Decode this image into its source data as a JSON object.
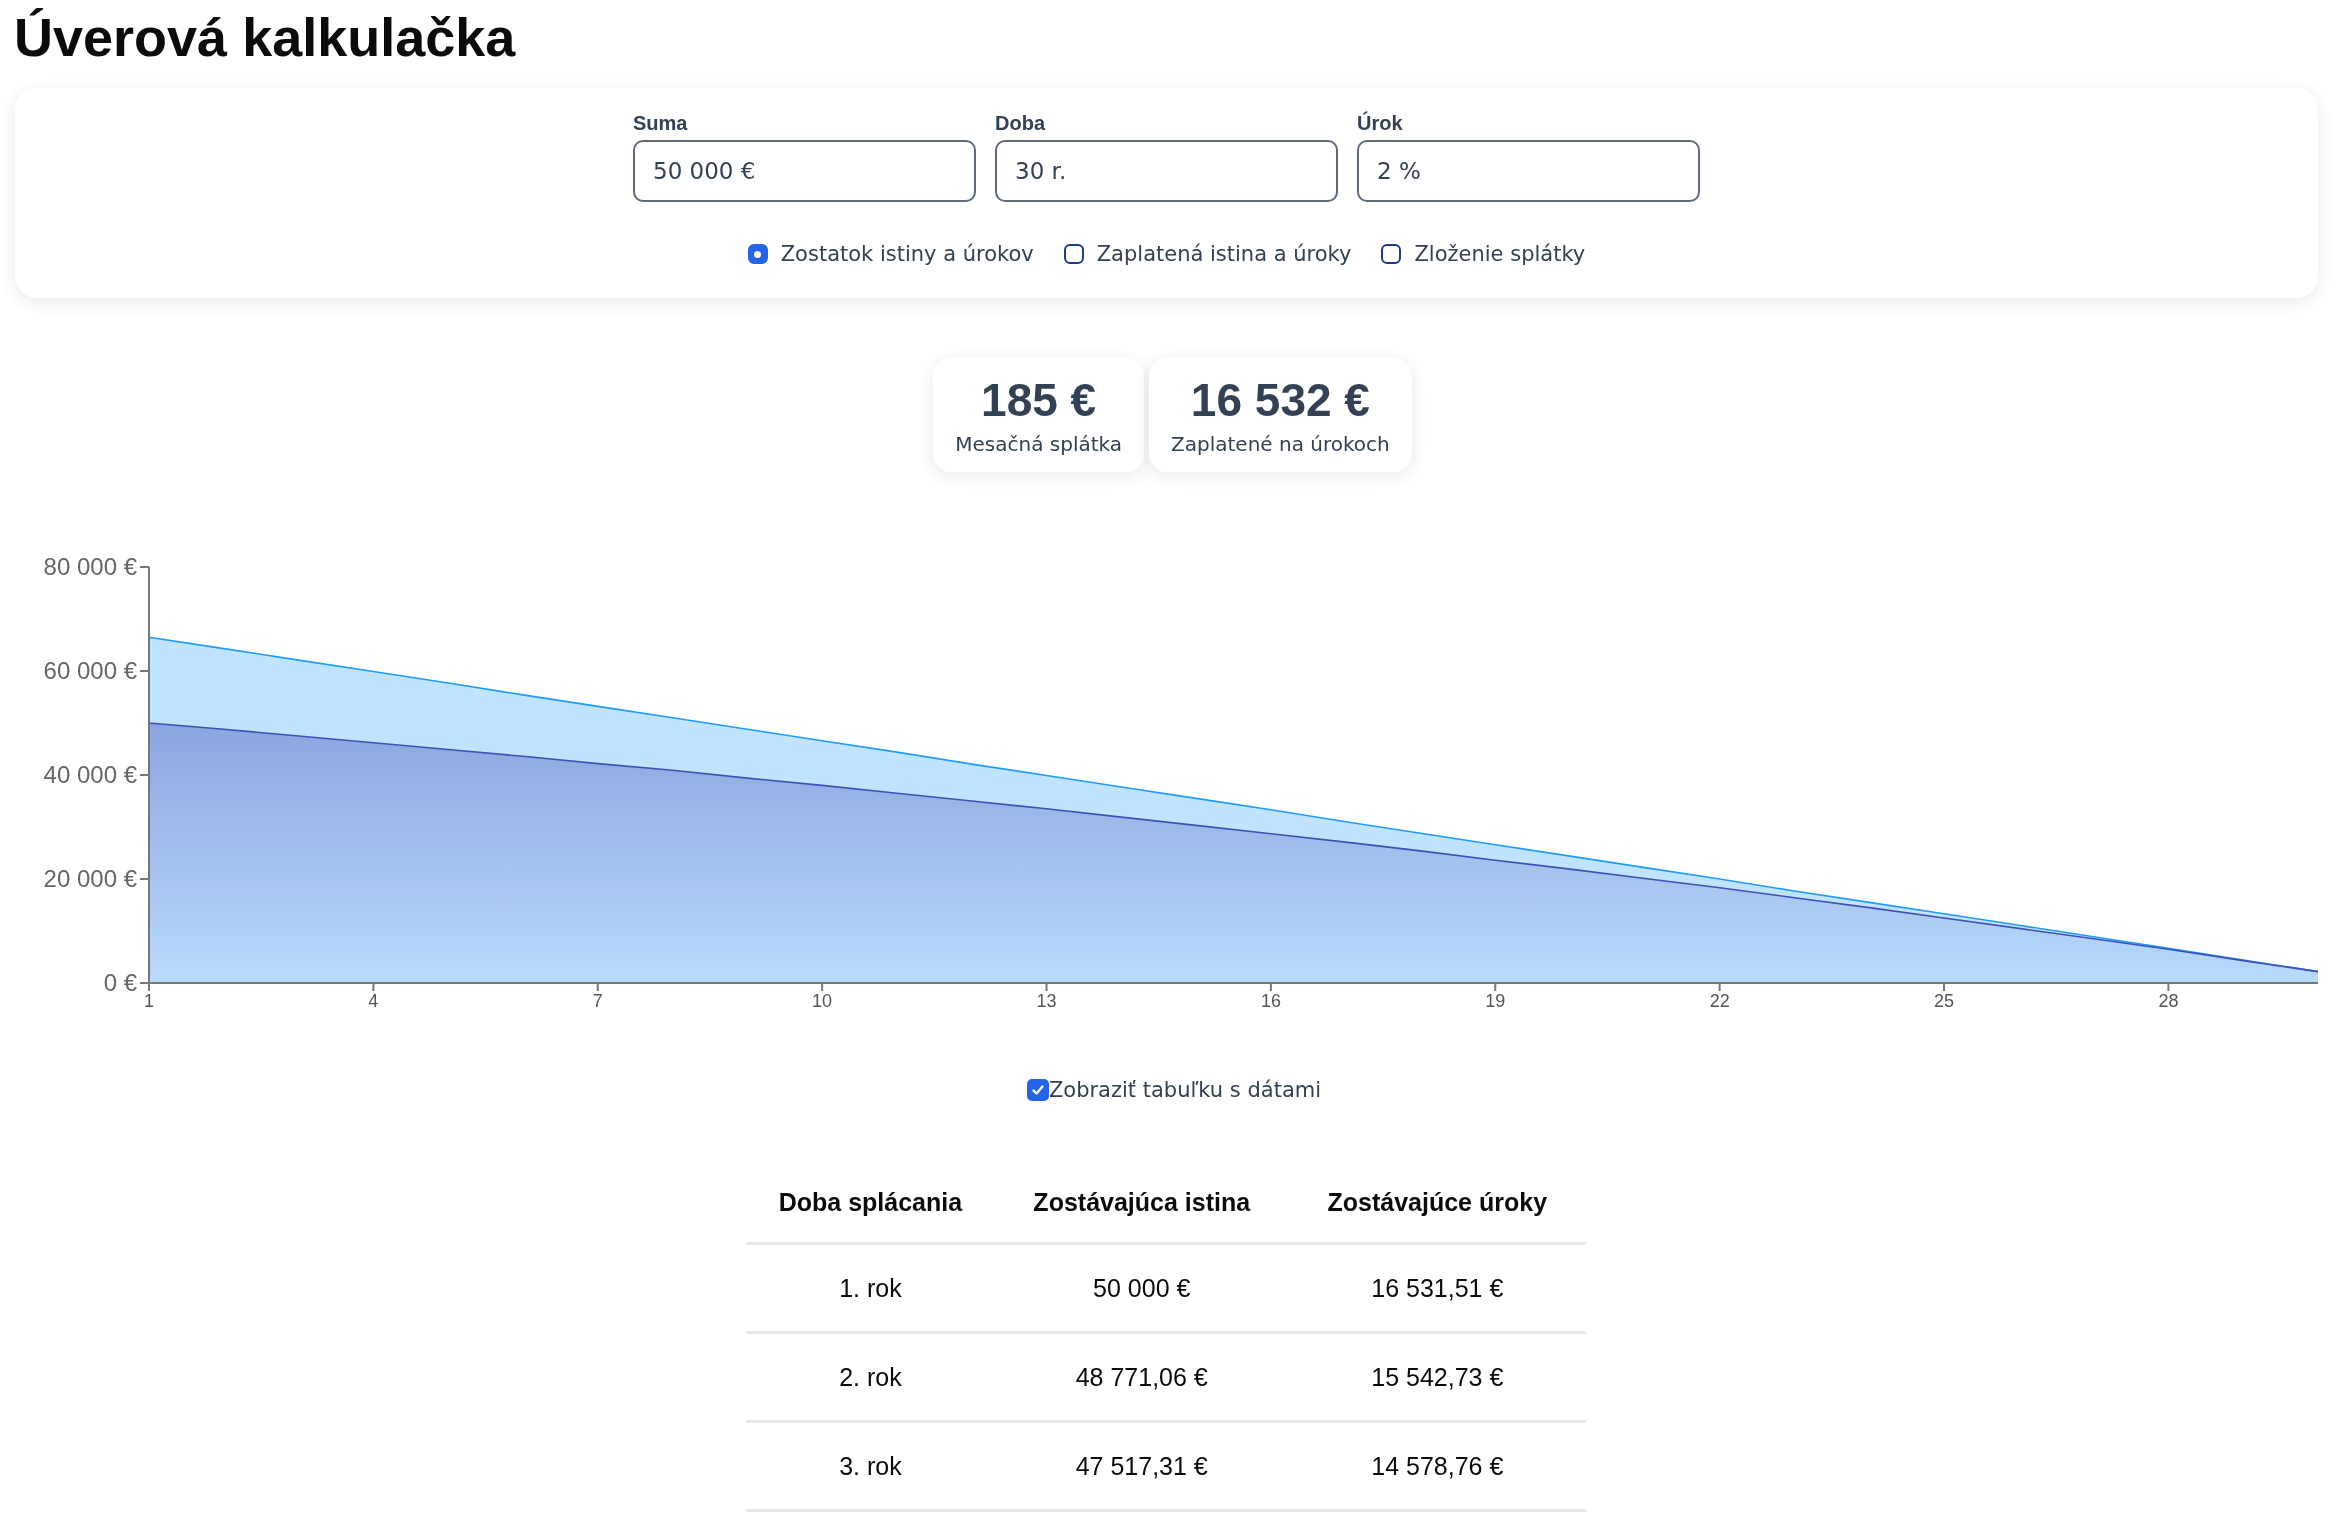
{
  "title": "Úverová kalkulačka",
  "fields": [
    {
      "label": "Suma",
      "value": "50 000 €"
    },
    {
      "label": "Doba",
      "value": "30 r."
    },
    {
      "label": "Úrok",
      "value": "2 %"
    }
  ],
  "view_options": [
    {
      "label": "Zostatok istiny a úrokov",
      "selected": true
    },
    {
      "label": "Zaplatená istina a úroky",
      "selected": false
    },
    {
      "label": "Zloženie splátky",
      "selected": false
    }
  ],
  "stats": [
    {
      "value": "185 €",
      "label": "Mesačná splátka"
    },
    {
      "value": "16 532 €",
      "label": "Zaplatené na úrokoch"
    }
  ],
  "chart": {
    "chart_data": {
      "type": "area",
      "stacked": false,
      "x": [
        1,
        2,
        3,
        4,
        5,
        6,
        7,
        8,
        9,
        10,
        11,
        12,
        13,
        14,
        15,
        16,
        17,
        18,
        19,
        20,
        21,
        22,
        23,
        24,
        25,
        26,
        27,
        28,
        29,
        30
      ],
      "series": [
        {
          "color": "#3f51b5",
          "values": [
            50000,
            48800,
            47500,
            46200,
            44900,
            43600,
            42200,
            40900,
            39400,
            38000,
            36500,
            35000,
            33500,
            31900,
            30300,
            28700,
            27100,
            25400,
            23600,
            21900,
            20100,
            18300,
            16400,
            14500,
            12500,
            10500,
            8500,
            6500,
            4300,
            2200
          ]
        },
        {
          "color": "#1e9bff",
          "values": [
            66500,
            64300,
            62100,
            59900,
            57700,
            55400,
            53200,
            51000,
            48800,
            46600,
            44400,
            42100,
            39900,
            37700,
            35500,
            33300,
            31000,
            28800,
            26600,
            24400,
            22200,
            20000,
            17700,
            15500,
            13300,
            11100,
            8900,
            6700,
            4400,
            2200
          ]
        }
      ],
      "xlim": [
        1,
        30
      ],
      "ylim": [
        0,
        80000
      ],
      "xticks": [
        1,
        4,
        7,
        10,
        13,
        16,
        19,
        22,
        25,
        28
      ],
      "yticks": [
        {
          "value": 0,
          "label": "0 €"
        },
        {
          "value": 20000,
          "label": "20 000 €"
        },
        {
          "value": 40000,
          "label": "40 000 €"
        },
        {
          "value": 60000,
          "label": "60 000 €"
        },
        {
          "value": 80000,
          "label": "80 000 €"
        }
      ]
    }
  },
  "show_table": {
    "label": "Zobraziť tabuľku s dátami",
    "checked": true
  },
  "table": {
    "columns": [
      "Doba splácania",
      "Zostávajúca istina",
      "Zostávajúce úroky"
    ],
    "rows": [
      [
        "1. rok",
        "50 000 €",
        "16 531,51 €"
      ],
      [
        "2. rok",
        "48 771,06 €",
        "15 542,73 €"
      ],
      [
        "3. rok",
        "47 517,31 €",
        "14 578,76 €"
      ]
    ]
  }
}
